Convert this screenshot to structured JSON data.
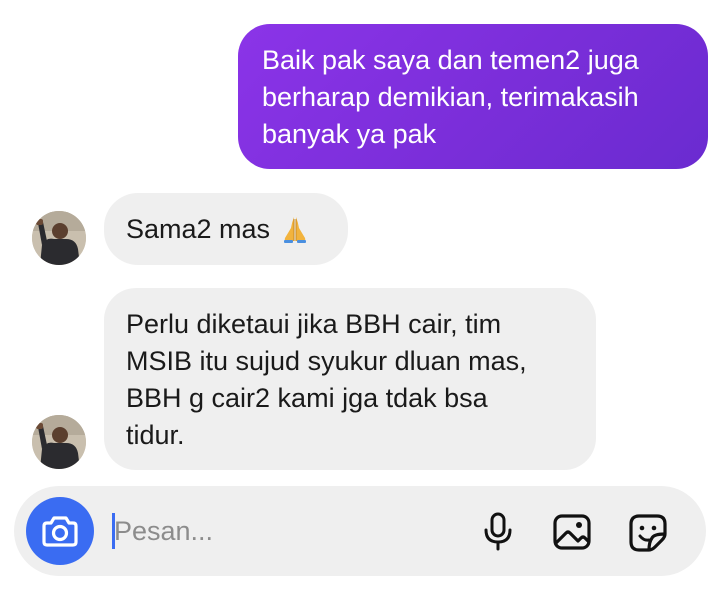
{
  "conversation": {
    "sent_message": "Baik pak saya dan temen2 juga\nberharap demikian, terimakasih\nbanyak ya pak",
    "received_messages": [
      {
        "text": "Sama2 mas",
        "emoji": "folded-hands"
      },
      {
        "text": "Perlu diketaui jika BBH cair, tim\nMSIB itu sujud syukur dluan mas,\nBBH g cair2 kami jga tdak bsa\ntidur."
      }
    ]
  },
  "composer": {
    "placeholder": "Pesan...",
    "value": ""
  },
  "icons": {
    "camera": "camera-icon",
    "mic": "microphone-icon",
    "gallery": "gallery-icon",
    "sticker": "sticker-icon"
  },
  "colors": {
    "sent_bubble": "#7a2ed9",
    "received_bubble": "#efefef",
    "accent": "#3a6cf2"
  }
}
